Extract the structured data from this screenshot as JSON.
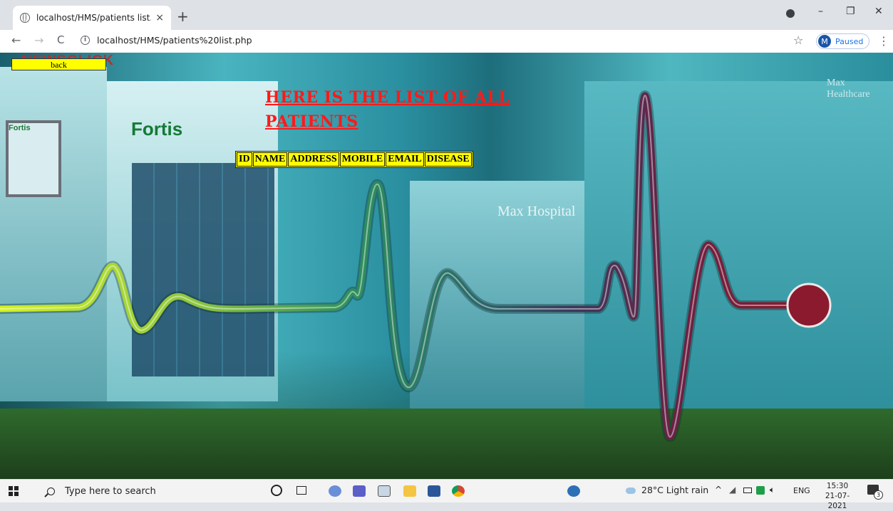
{
  "browser": {
    "tab_title": "localhost/HMS/patients list.php",
    "tab_close": "×",
    "new_tab": "+",
    "url": "localhost/HMS/patients%20list.php",
    "profile_initial": "M",
    "profile_status": "Paused",
    "nav_back": "←",
    "nav_forward": "→",
    "nav_reload": "C",
    "bookmark_star": "☆",
    "menu": "⋮",
    "window_minimize": "–",
    "window_restore": "❐",
    "window_close": "✕"
  },
  "page": {
    "back_label": "back",
    "logo_text": "NEWSCLICK",
    "heading": "HERE IS THE LIST OF ALL PATIENTS",
    "table": {
      "columns": [
        "ID",
        "NAME",
        "ADDRESS",
        "MOBILE",
        "EMAIL",
        "DISEASE"
      ]
    },
    "background_signs": {
      "fortis": "Fortis",
      "fortis_small": "Fortis",
      "max": "Max Hospital",
      "max_healthcare": "Max Healthcare"
    }
  },
  "taskbar": {
    "search_placeholder": "Type here to search",
    "weather": "28°C  Light rain",
    "language": "ENG",
    "time": "15:30",
    "date": "21-07-2021",
    "notification_count": "3"
  },
  "colors": {
    "heading": "#ff1a1a",
    "table_bg": "#ffff00",
    "back_bg": "#ffff00"
  }
}
